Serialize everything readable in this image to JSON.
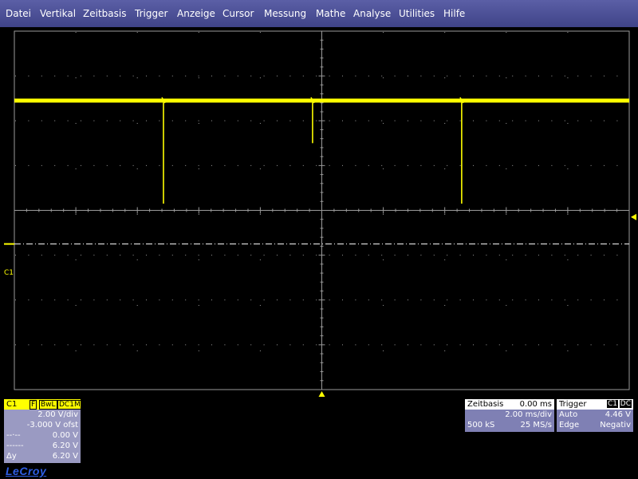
{
  "menu": [
    "Datei",
    "Vertikal",
    "Zeitbasis",
    "Trigger",
    "Anzeige",
    "Cursor",
    "Messung",
    "Mathe",
    "Analyse",
    "Utilities",
    "Hilfe"
  ],
  "colors": {
    "trace": "#ffff00",
    "grid": "#9a9a9a",
    "menubar": "#4a4e95",
    "channel_panel": "#9a9ac2",
    "info_panel": "#7f80b4"
  },
  "screen": {
    "h_divs": 10,
    "v_divs": 8,
    "trace_level_div": 1.55,
    "ground_marker_label": "C1",
    "glitches": [
      {
        "t_div": 4.85,
        "depth_div": 2.3
      },
      {
        "t_div": 9.7,
        "depth_div": 0.95
      },
      {
        "t_div": 14.55,
        "depth_div": 2.3
      }
    ]
  },
  "channel": {
    "name": "C1",
    "flag": "F",
    "bwl": "BwL",
    "coupling": "DC1M",
    "vdiv": "2.00 V/div",
    "offset": "-3.000 V ofst",
    "cursor1_label": "--·--",
    "cursor1_value": "0.00 V",
    "cursor2_label": "------",
    "cursor2_value": "6.20 V",
    "delta_label": "Δy",
    "delta_value": "6.20 V"
  },
  "timebase": {
    "title": "Zeitbasis",
    "delay": "0.00 ms",
    "tdiv": "2.00 ms/div",
    "samples": "500 kS",
    "rate": "25 MS/s"
  },
  "trigger": {
    "title": "Trigger",
    "source": "C1",
    "coupling": "DC",
    "mode": "Auto",
    "level": "4.46 V",
    "type": "Edge",
    "slope": "Negativ"
  },
  "brand": "LeCroy"
}
